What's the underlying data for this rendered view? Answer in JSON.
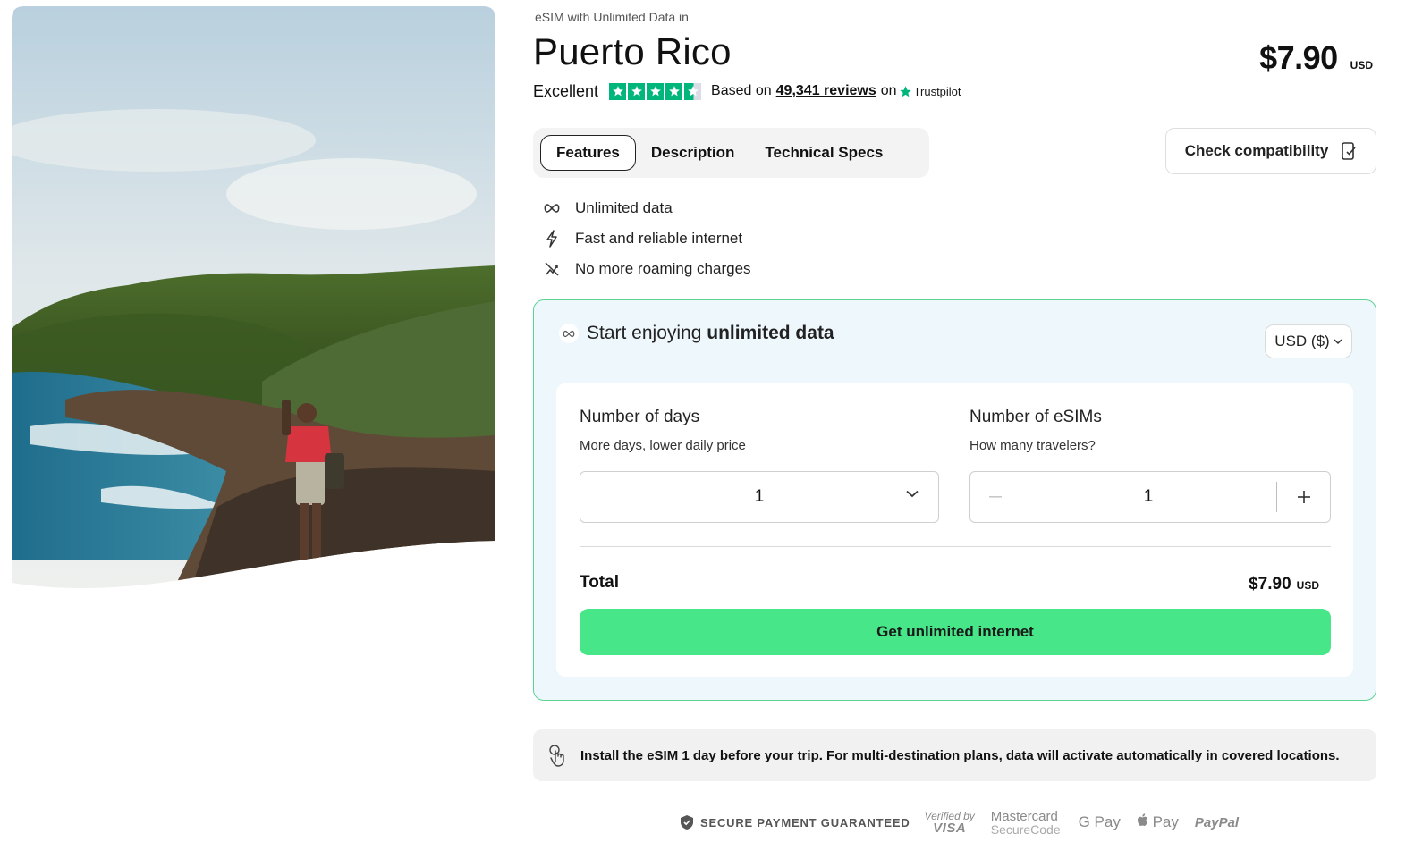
{
  "header": {
    "eyebrow": "eSIM with Unlimited Data in",
    "country": "Puerto Rico",
    "price": "$7.90",
    "price_currency": "USD"
  },
  "rating": {
    "label": "Excellent",
    "stars": 4.5,
    "based_on": "Based on",
    "reviews": "49,341 reviews",
    "on": "on",
    "provider": "Trustpilot",
    "color": "#00b67a"
  },
  "tabs": [
    {
      "label": "Features",
      "active": true
    },
    {
      "label": "Description",
      "active": false
    },
    {
      "label": "Technical Specs",
      "active": false
    }
  ],
  "check_compatibility": "Check compatibility",
  "features": [
    {
      "icon": "infinity-icon",
      "label": "Unlimited data"
    },
    {
      "icon": "lightning-icon",
      "label": "Fast and reliable internet"
    },
    {
      "icon": "no-roaming-icon",
      "label": "No more roaming charges"
    }
  ],
  "card": {
    "heading_plain": "Start enjoying",
    "heading_bold": "unlimited data",
    "currency_select": "USD ($)",
    "days_title": "Number of days",
    "days_sub": "More days, lower daily price",
    "days_value": "1",
    "esims_title": "Number of eSIMs",
    "esims_sub": "How many travelers?",
    "esims_value": "1",
    "total_label": "Total",
    "total_amount": "$7.90",
    "total_currency": "USD",
    "cta": "Get unlimited internet",
    "accent": "#47e689",
    "border": "#5ad393"
  },
  "notice": "Install the eSIM 1 day before your trip. For multi-destination plans, data will activate automatically in covered locations.",
  "payment": {
    "secure": "SECURE PAYMENT GUARANTEED",
    "verified_by": "Verified by",
    "visa": "VISA",
    "mastercard": "Mastercard",
    "securecode": "SecureCode",
    "gpay": "G Pay",
    "applepay": "Pay",
    "paypal": "PayPal"
  }
}
